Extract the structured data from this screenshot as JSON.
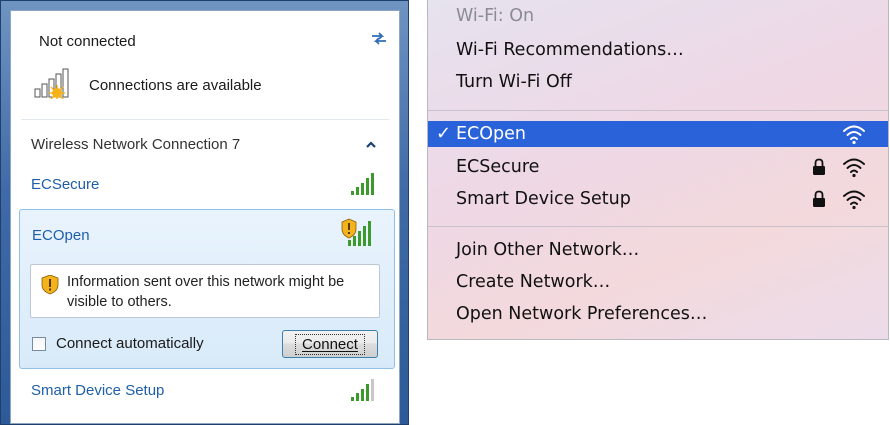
{
  "win7": {
    "status_title": "Not connected",
    "connections_text": "Connections are available",
    "section_title": "Wireless Network Connection 7",
    "networks": [
      {
        "name": "ECSecure",
        "signal_bars": 5
      },
      {
        "name": "ECOpen",
        "signal_bars": 5,
        "unsecured": true
      },
      {
        "name": "Smart Device Setup",
        "signal_bars": 4
      }
    ],
    "info_text": "Information sent over this network might be visible to others.",
    "connect_auto_label": "Connect automatically",
    "connect_auto_checked": false,
    "connect_button": "Connect",
    "icons": {
      "refresh": "refresh-arrows-icon",
      "collapse": "chevron-up-icon",
      "warning": "shield-warning-icon"
    },
    "colors": {
      "link": "#1f5fa8",
      "selection": "#d8eaf9"
    }
  },
  "mac": {
    "status": "Wi-Fi: On",
    "recommendations": "Wi-Fi Recommendations…",
    "turn_off": "Turn Wi-Fi Off",
    "networks": [
      {
        "name": "ECOpen",
        "selected": true,
        "checkmark": "✓",
        "locked": false
      },
      {
        "name": "ECSecure",
        "selected": false,
        "locked": true
      },
      {
        "name": "Smart Device Setup",
        "selected": false,
        "locked": true
      }
    ],
    "join_other": "Join Other Network…",
    "create": "Create Network…",
    "open_prefs": "Open Network Preferences…",
    "icons": {
      "wifi": "wifi-icon",
      "lock": "lock-icon"
    },
    "colors": {
      "selected": "#2a62d9"
    }
  }
}
